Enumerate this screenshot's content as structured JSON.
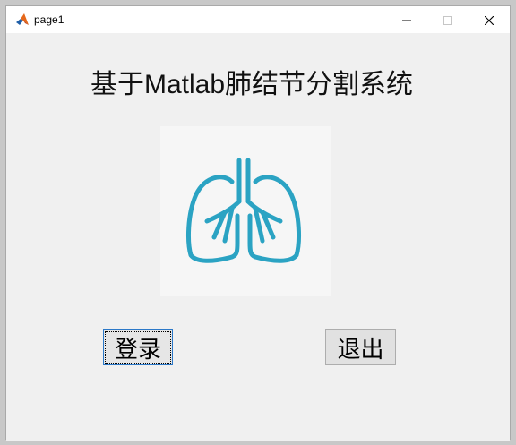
{
  "window": {
    "title": "page1",
    "app_icon": "matlab-icon",
    "controls": {
      "minimize_icon": "minimize-icon",
      "maximize_icon": "maximize-icon",
      "close_icon": "close-icon"
    }
  },
  "main": {
    "title": "基于Matlab肺结节分割系统",
    "image_icon": "lungs-icon",
    "lung_color": "#2ba3c3",
    "login_label": "登录",
    "exit_label": "退出"
  }
}
